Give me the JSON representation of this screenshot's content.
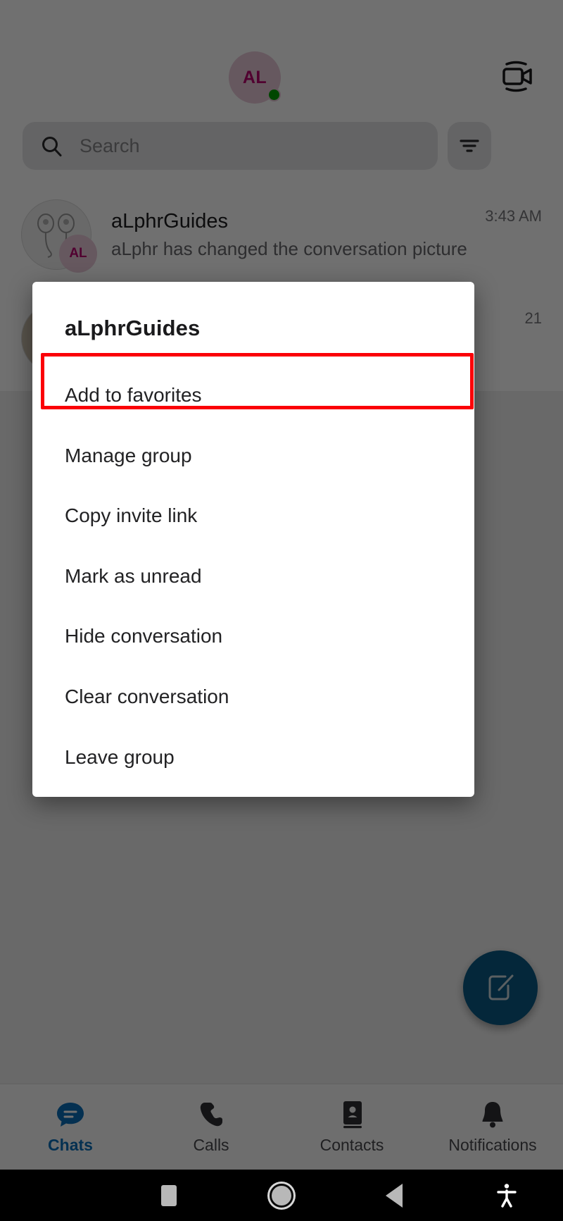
{
  "header": {
    "avatar_initials": "AL",
    "avatar_status": "online",
    "video_icon": "video-camera-icon"
  },
  "search": {
    "placeholder": "Search",
    "value": "",
    "search_icon": "search-icon",
    "filter_icon": "filter-icon"
  },
  "chats": [
    {
      "title": "aLphrGuides",
      "subtitle": "aLphr has changed the conversation picture",
      "time": "3:43 AM",
      "badge_initials": "AL"
    },
    {
      "title": "",
      "subtitle": "",
      "time": "21",
      "badge_initials": ""
    }
  ],
  "fab": {
    "icon": "compose-icon",
    "color": "#0a5a85"
  },
  "tabbar": {
    "active": "Chats",
    "active_color": "#0b6fb8",
    "items": [
      {
        "label": "Chats",
        "icon": "chat-bubble-icon"
      },
      {
        "label": "Calls",
        "icon": "phone-icon"
      },
      {
        "label": "Contacts",
        "icon": "address-book-icon"
      },
      {
        "label": "Notifications",
        "icon": "bell-icon"
      }
    ]
  },
  "dialog": {
    "title": "aLphrGuides",
    "highlight_color": "#fb0007",
    "highlighted_item": "Add to favorites",
    "items": [
      {
        "label": "Add to favorites",
        "highlighted": true
      },
      {
        "label": "Manage group",
        "highlighted": false
      },
      {
        "label": "Copy invite link",
        "highlighted": false
      },
      {
        "label": "Mark as unread",
        "highlighted": false
      },
      {
        "label": "Hide conversation",
        "highlighted": false
      },
      {
        "label": "Clear conversation",
        "highlighted": false
      },
      {
        "label": "Leave group",
        "highlighted": false
      }
    ]
  },
  "system_nav": {
    "buttons": [
      {
        "name": "recents",
        "icon": "square-icon"
      },
      {
        "name": "home",
        "icon": "circle-icon"
      },
      {
        "name": "back",
        "icon": "triangle-left-icon"
      },
      {
        "name": "accessibility",
        "icon": "accessibility-icon"
      }
    ]
  }
}
